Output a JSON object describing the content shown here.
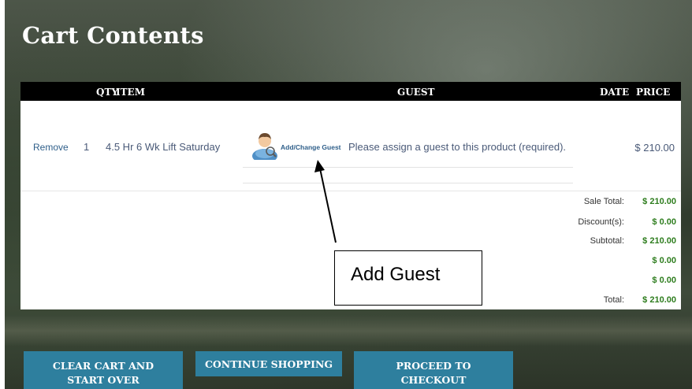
{
  "page": {
    "title": "Cart Contents"
  },
  "table": {
    "headers": {
      "qty": "QTY",
      "item": "ITEM",
      "guest": "GUEST",
      "date": "DATE",
      "price": "PRICE"
    },
    "row": {
      "remove": "Remove",
      "qty": "1",
      "item": "4.5 Hr 6 Wk Lift Saturday",
      "add_guest": "Add/Change Guest",
      "guest_msg": "Please assign a guest to this product (required).",
      "price": "$ 210.00"
    }
  },
  "summary": [
    {
      "label": "Sale Total:",
      "value": "$ 210.00"
    },
    {
      "label": "Discount(s):",
      "value": "$ 0.00"
    },
    {
      "label": "Subtotal:",
      "value": "$ 210.00"
    },
    {
      "label": "",
      "value": "$ 0.00"
    },
    {
      "label": "",
      "value": "$ 0.00"
    },
    {
      "label": "Total:",
      "value": "$ 210.00"
    }
  ],
  "annotation": {
    "text": "Add Guest"
  },
  "buttons": {
    "clear_line1": "CLEAR CART AND",
    "clear_line2": "START OVER",
    "continue": "CONTINUE SHOPPING",
    "checkout_line1": "PROCEED TO",
    "checkout_line2": "CHECKOUT"
  },
  "colors": {
    "button": "#2e7f9e",
    "link": "#2f5f8a",
    "money": "#2e7d1e",
    "header": "#000000"
  }
}
